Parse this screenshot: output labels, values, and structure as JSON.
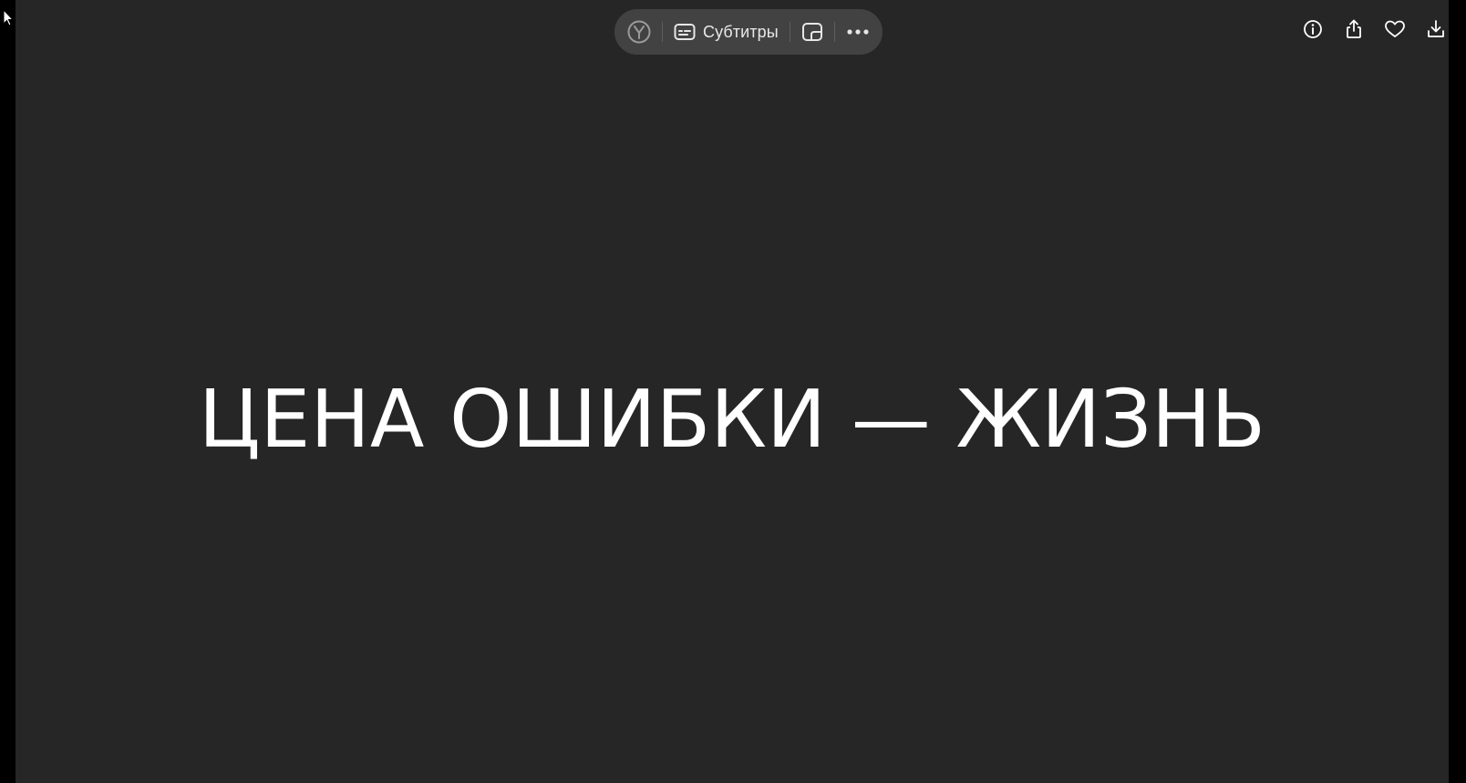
{
  "toolbar": {
    "yandex_icon": "yandex-logo-icon",
    "subtitles_icon": "subtitles-icon",
    "subtitles_label": "Субтитры",
    "pip_icon": "picture-in-picture-icon",
    "more_icon": "more-dots-icon"
  },
  "top_right": {
    "icons": [
      "info-icon",
      "share-icon",
      "heart-icon",
      "download-icon"
    ]
  },
  "video": {
    "caption_text": "ЦЕНА ОШИБКИ — ЖИЗНЬ"
  },
  "colors": {
    "background": "#262626",
    "letterbox": "#000000",
    "toolbar_bg": "#424242",
    "text": "#ffffff"
  }
}
